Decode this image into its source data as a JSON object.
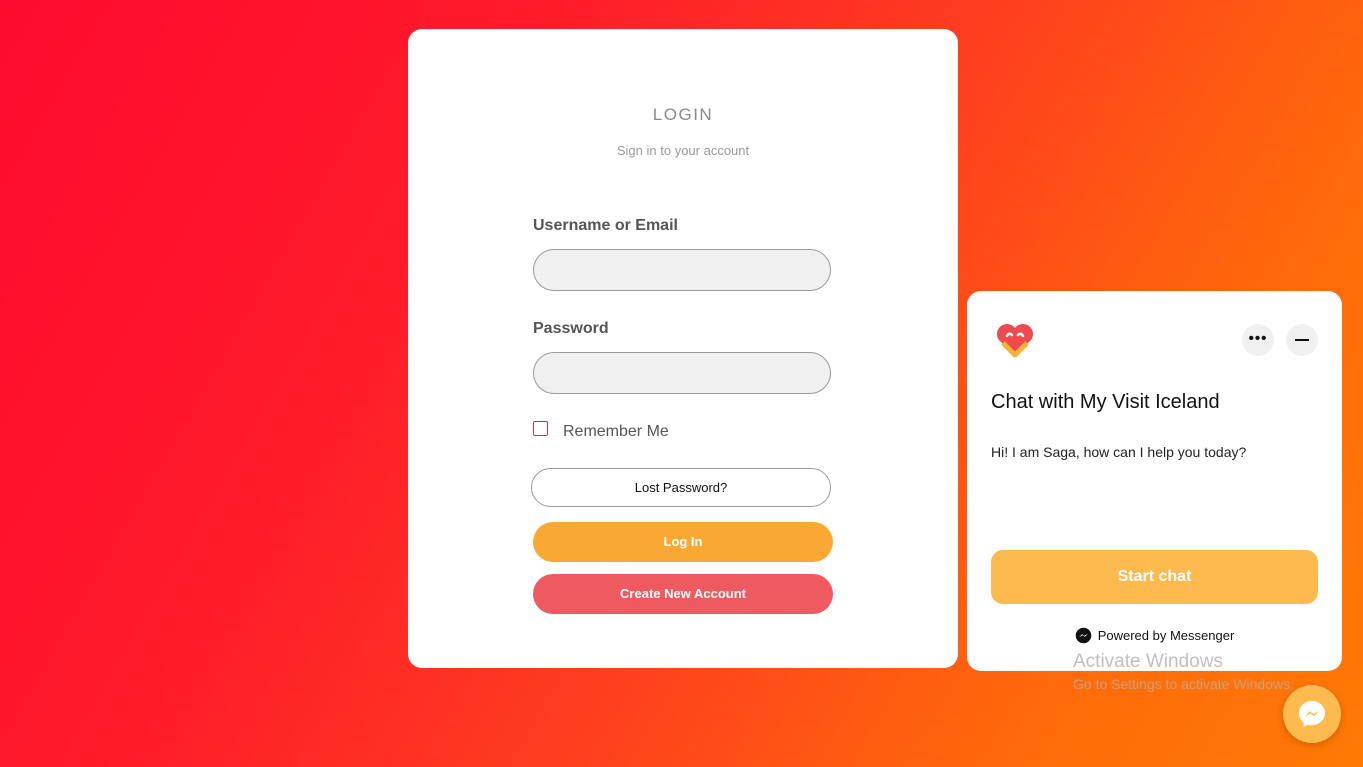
{
  "login": {
    "title": "LOGIN",
    "subtitle": "Sign in to your account",
    "username_label": "Username or Email",
    "username_value": "",
    "password_label": "Password",
    "password_value": "",
    "remember_label": "Remember Me",
    "remember_checked": false,
    "lost_password_label": "Lost Password?",
    "login_label": "Log In",
    "create_account_label": "Create New Account"
  },
  "chat": {
    "logo_icon": "heart-logo-icon",
    "title": "Chat with My Visit Iceland",
    "message": "Hi! I am Saga, how can I help you today?",
    "start_label": "Start chat",
    "powered_by": "Powered by Messenger",
    "more_icon": "more-horizontal-icon",
    "minimize_icon": "minimize-icon"
  },
  "watermark": {
    "title": "Activate Windows",
    "subtitle": "Go to Settings to activate Windows."
  },
  "colors": {
    "background_start": "#ff0a2e",
    "background_end": "#ff7a05",
    "login_button": "#f9a933",
    "create_button": "#ee5a5f",
    "chat_button": "#fdba4f"
  }
}
